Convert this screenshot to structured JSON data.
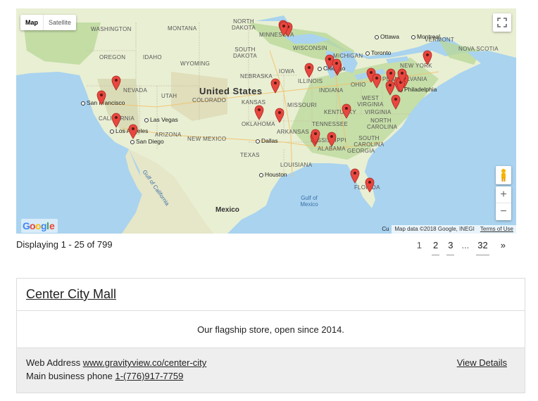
{
  "map": {
    "type_buttons": [
      "Map",
      "Satellite"
    ],
    "google_logo": "Google",
    "attribution": "Map data ©2018 Google, INEGI",
    "terms": "Terms of Use",
    "cut_off_text": "Cu",
    "country_labels": [
      "United States",
      "Mexico"
    ],
    "state_labels": [
      "WASHINGTON",
      "MONTANA",
      "NORTH DAKOTA",
      "MINNESOTA",
      "SOUTH DAKOTA",
      "WISCONSIN",
      "OREGON",
      "IDAHO",
      "WYOMING",
      "NEBRASKA",
      "IOWA",
      "MICHIGAN",
      "NEVADA",
      "UTAH",
      "COLORADO",
      "KANSAS",
      "ILLINOIS",
      "INDIANA",
      "OHIO",
      "PENNSYLVANIA",
      "NEW YORK",
      "VERMONT",
      "CALIFORNIA",
      "ARIZONA",
      "NEW MEXICO",
      "OKLAHOMA",
      "MISSOURI",
      "KENTUCKY",
      "WEST VIRGINIA",
      "VIRGINIA",
      "TEXAS",
      "ARKANSAS",
      "TENNESSEE",
      "NORTH CAROLINA",
      "SOUTH CAROLINA",
      "MISSISSIPPI",
      "ALABAMA",
      "GEORGIA",
      "LOUISIANA",
      "FLORIDA",
      "NOVA SCOTIA"
    ],
    "cities": [
      "Ottawa",
      "Montreal",
      "Toronto",
      "Chicago",
      "Philadelphia",
      "San Francisco",
      "Las Vegas",
      "Los Angeles",
      "San Diego",
      "Dallas",
      "Houston"
    ],
    "water_labels": [
      "Gulf of California",
      "Gulf of Mexico"
    ],
    "marker_count": 30
  },
  "listing": {
    "displaying": "Displaying 1 - 25 of 799",
    "pagination": {
      "current": "1",
      "pages": [
        "2",
        "3"
      ],
      "ellipsis": "...",
      "last": "32",
      "next": "»"
    }
  },
  "entry": {
    "title": "Center City Mall",
    "description": "Our flagship store, open since 2014.",
    "web_label": "Web Address",
    "web_value": "www.gravityview.co/center-city",
    "phone_label": "Main business phone",
    "phone_value": "1-(776)917-7759",
    "details_link": "View Details"
  },
  "colors": {
    "water": "#a9d3ef",
    "land": "#e9efd3",
    "forest": "#b9d89a",
    "marker": "#e8473f",
    "google_blue": "#4285F4",
    "google_red": "#EA4335",
    "google_yellow": "#FBBC05",
    "google_green": "#34A853"
  }
}
